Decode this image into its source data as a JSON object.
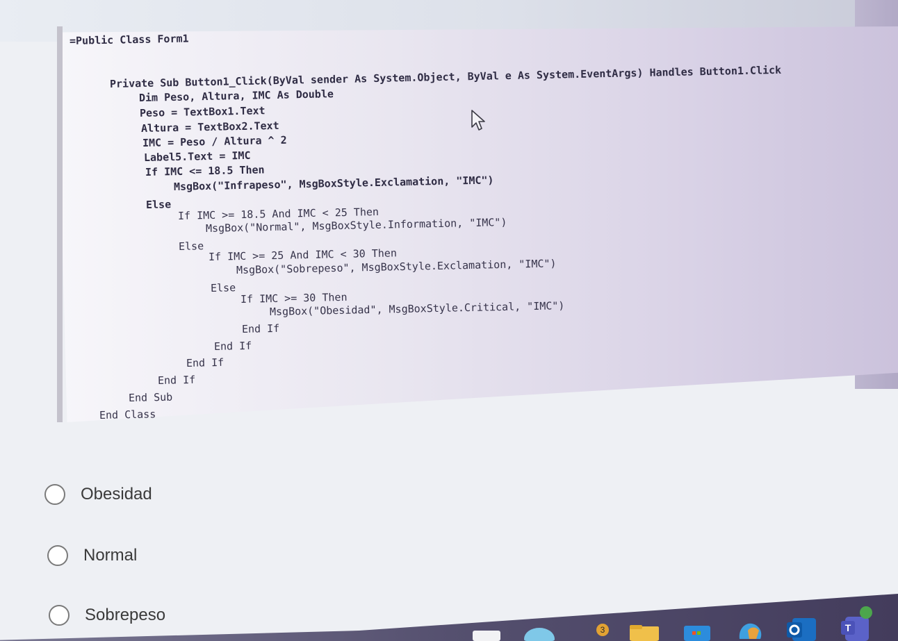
{
  "code": {
    "lines": [
      "=Public Class Form1",
      "Private Sub Button1_Click(ByVal sender As System.Object, ByVal e As System.EventArgs) Handles Button1.Click",
      "Dim Peso, Altura, IMC As Double",
      "Peso = TextBox1.Text",
      "Altura = TextBox2.Text",
      "IMC = Peso / Altura ^ 2",
      "Label5.Text = IMC",
      "If IMC <= 18.5 Then",
      "MsgBox(\"Infrapeso\", MsgBoxStyle.Exclamation, \"IMC\")",
      "Else",
      "If IMC >= 18.5 And IMC < 25 Then",
      "MsgBox(\"Normal\", MsgBoxStyle.Information, \"IMC\")",
      "Else",
      "If IMC >= 25 And IMC < 30 Then",
      "MsgBox(\"Sobrepeso\", MsgBoxStyle.Exclamation, \"IMC\")",
      "Else",
      "If IMC >= 30 Then",
      "MsgBox(\"Obesidad\", MsgBoxStyle.Critical, \"IMC\")",
      "End If",
      "End If",
      "End If",
      "End If",
      "End Sub",
      "End Class"
    ]
  },
  "options": [
    {
      "label": "Obesidad"
    },
    {
      "label": "Normal"
    },
    {
      "label": "Sobrepeso"
    }
  ],
  "taskbar": {
    "badge_count": "3",
    "icons": [
      "widgets-icon",
      "chat-icon",
      "notification-badge-icon",
      "file-explorer-icon",
      "store-icon",
      "copilot-icon",
      "outlook-icon",
      "teams-icon"
    ]
  },
  "colors": {
    "code_text": "#36334a",
    "panel_bg": "#ece9f2",
    "radio_border": "#7a7a7a",
    "option_text": "#3a3a3a"
  }
}
